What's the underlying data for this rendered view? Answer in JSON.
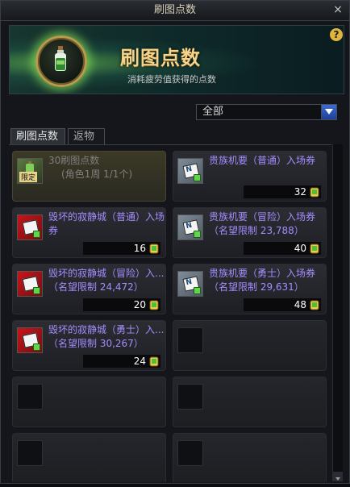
{
  "window": {
    "title": "刷图点数",
    "close_label": "×"
  },
  "banner": {
    "title": "刷图点数",
    "subtitle": "消耗疲劳值获得的点数",
    "help_label": "?"
  },
  "filter": {
    "selected": "全部"
  },
  "tabs": [
    {
      "label": "刷图点数",
      "active": true
    },
    {
      "label": "返物",
      "active": false
    }
  ],
  "items": [
    {
      "name": "30刷图点数",
      "sub": "(角色1周 1/1个)",
      "icon": "green-bottle-limited",
      "limited_label": "限定"
    },
    {
      "name": "贵族机要（普通）入场券",
      "price": "32",
      "icon": "blue-ticket"
    },
    {
      "name": "毁坏的寂静城（普通）入场券",
      "price": "16",
      "icon": "red-ticket"
    },
    {
      "name": "贵族机要（冒险）入场券（名望限制 23,788）",
      "price": "40",
      "icon": "blue-ticket"
    },
    {
      "name": "毁坏的寂静城（冒险）入...（名望限制 24,472）",
      "price": "20",
      "icon": "red-ticket"
    },
    {
      "name": "贵族机要（勇士）入场券（名望限制 29,631）",
      "price": "48",
      "icon": "blue-ticket"
    },
    {
      "name": "毁坏的寂静城（勇士）入...（名望限制 30,267）",
      "price": "24",
      "icon": "red-ticket"
    }
  ]
}
